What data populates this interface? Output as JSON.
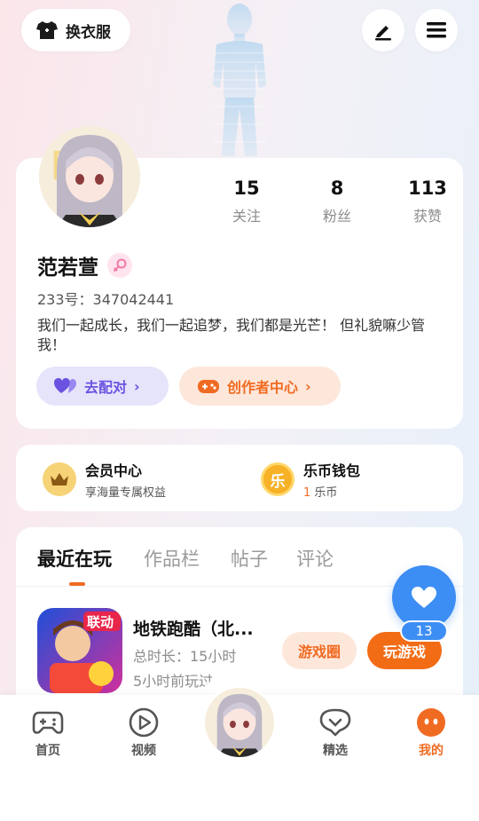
{
  "header": {
    "outfit_label": "换衣服",
    "edit_icon": "edit-icon",
    "menu_icon": "menu-icon"
  },
  "profile": {
    "stats": [
      {
        "value": "15",
        "label": "关注"
      },
      {
        "value": "8",
        "label": "粉丝"
      },
      {
        "value": "113",
        "label": "获赞"
      }
    ],
    "nickname": "范若萱",
    "uid": "233号：347042441",
    "bio": "我们一起成长，我们一起追梦，我们都是光芒！ 但礼貌嘛少管我！",
    "match_label": "去配对",
    "creator_label": "创作者中心"
  },
  "vip": {
    "member_title": "会员中心",
    "member_sub": "享海量专属权益",
    "wallet_title": "乐币钱包",
    "wallet_amount": "1",
    "wallet_unit": "乐币",
    "coin_char": "乐"
  },
  "tabs": {
    "items": [
      "最近在玩",
      "作品栏",
      "帖子",
      "评论"
    ],
    "active": 0
  },
  "recent_game": {
    "title": "地铁跑酷（北...",
    "duration": "总时长：15小时",
    "last_played": "5小时前玩过",
    "badge": "联动",
    "circle_label": "游戏圈",
    "play_label": "玩游戏"
  },
  "float_like": {
    "count": "13"
  },
  "bottom_nav": {
    "items": [
      {
        "label": "首页",
        "icon": "gamepad-icon"
      },
      {
        "label": "视频",
        "icon": "video-icon"
      },
      {
        "label": "精选",
        "icon": "heart-chat-icon"
      },
      {
        "label": "我的",
        "icon": "face-icon"
      }
    ],
    "active": 3
  },
  "colors": {
    "accent": "#f06b22",
    "like_blue": "#3d8ef4",
    "match_purple": "#6b52e0"
  }
}
